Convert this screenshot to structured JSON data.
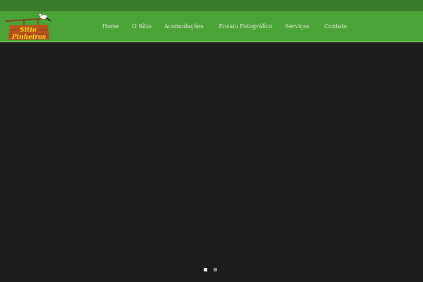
{
  "logo": {
    "text_line1": "Sitio",
    "text_line2": "Pinheiros"
  },
  "nav": {
    "items": [
      {
        "label": "Home"
      },
      {
        "label": "O Sítio"
      },
      {
        "label": "Acomodações"
      },
      {
        "label": "Ensaio Fotográfico"
      },
      {
        "label": "Serviços"
      },
      {
        "label": "Contato"
      }
    ]
  },
  "slider": {
    "slides": 2,
    "active": 1
  },
  "colors": {
    "topbar": "#3a7b2a",
    "nav": "#4aa336",
    "background": "#1d1d1d"
  }
}
